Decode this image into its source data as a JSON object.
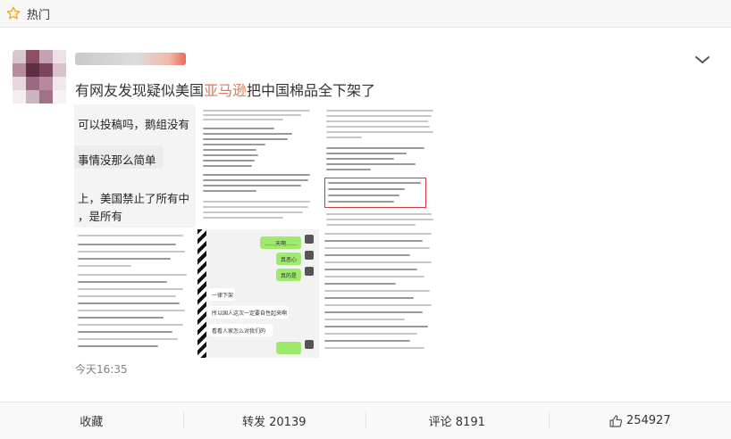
{
  "topbar": {
    "label": "热门",
    "icon": "star-icon"
  },
  "post": {
    "text_before": "有网友发现疑似美国",
    "text_highlight": "亚马逊",
    "text_after": "把中国棉品全下架了",
    "timestamp": "今天16:35"
  },
  "image1": {
    "line1": "可以投稿吗，鹅组没有",
    "line2": "事情没那么简单",
    "line3": "上，美国禁止了所有中",
    "line4": "，是所有"
  },
  "chat": {
    "bubble1": "……天啊……",
    "bubble2": "真恶心",
    "bubble3": "真的是",
    "msg1": "一律下架",
    "msg2": "所以国人这次一定要自性起来啊",
    "msg3": "看看人家怎么对我们的"
  },
  "actions": {
    "favorite": "收藏",
    "repost": "转发 20139",
    "comment": "评论 8191",
    "like": "254927"
  },
  "colors": {
    "highlight": "#eb7350",
    "star": "#f5a623",
    "redbox": "#d43a3a"
  }
}
